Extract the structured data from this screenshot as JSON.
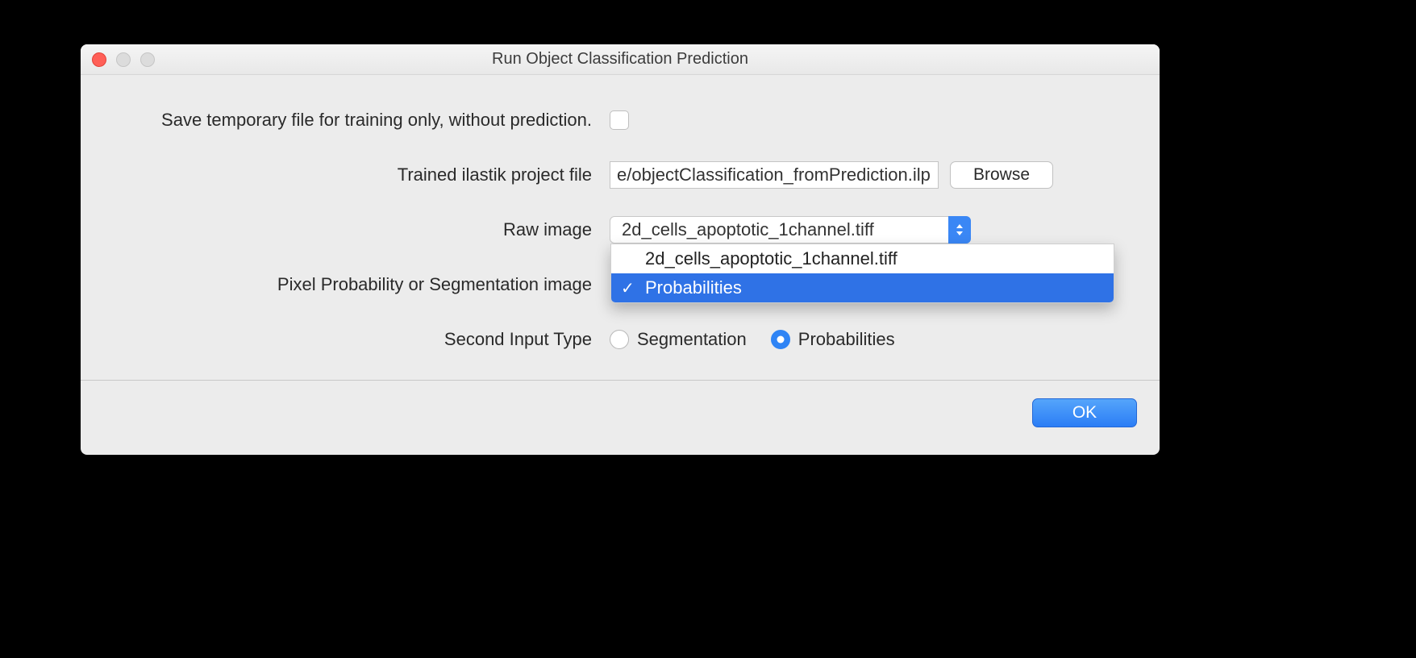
{
  "window": {
    "title": "Run Object Classification Prediction"
  },
  "form": {
    "save_temp_label": "Save temporary file for training only, without prediction.",
    "project_file_label": "Trained ilastik project file",
    "project_file_value": "e/objectClassification_fromPrediction.ilp",
    "browse_label": "Browse",
    "raw_image_label": "Raw image",
    "raw_image_value": "2d_cells_apoptotic_1channel.tiff",
    "pixel_prob_label": "Pixel Probability or Segmentation image",
    "second_input_label": "Second Input Type",
    "ok_label": "OK"
  },
  "dropdown": {
    "item_0": "2d_cells_apoptotic_1channel.tiff",
    "item_1": "Probabilities"
  },
  "radio": {
    "segmentation": "Segmentation",
    "probabilities": "Probabilities"
  }
}
